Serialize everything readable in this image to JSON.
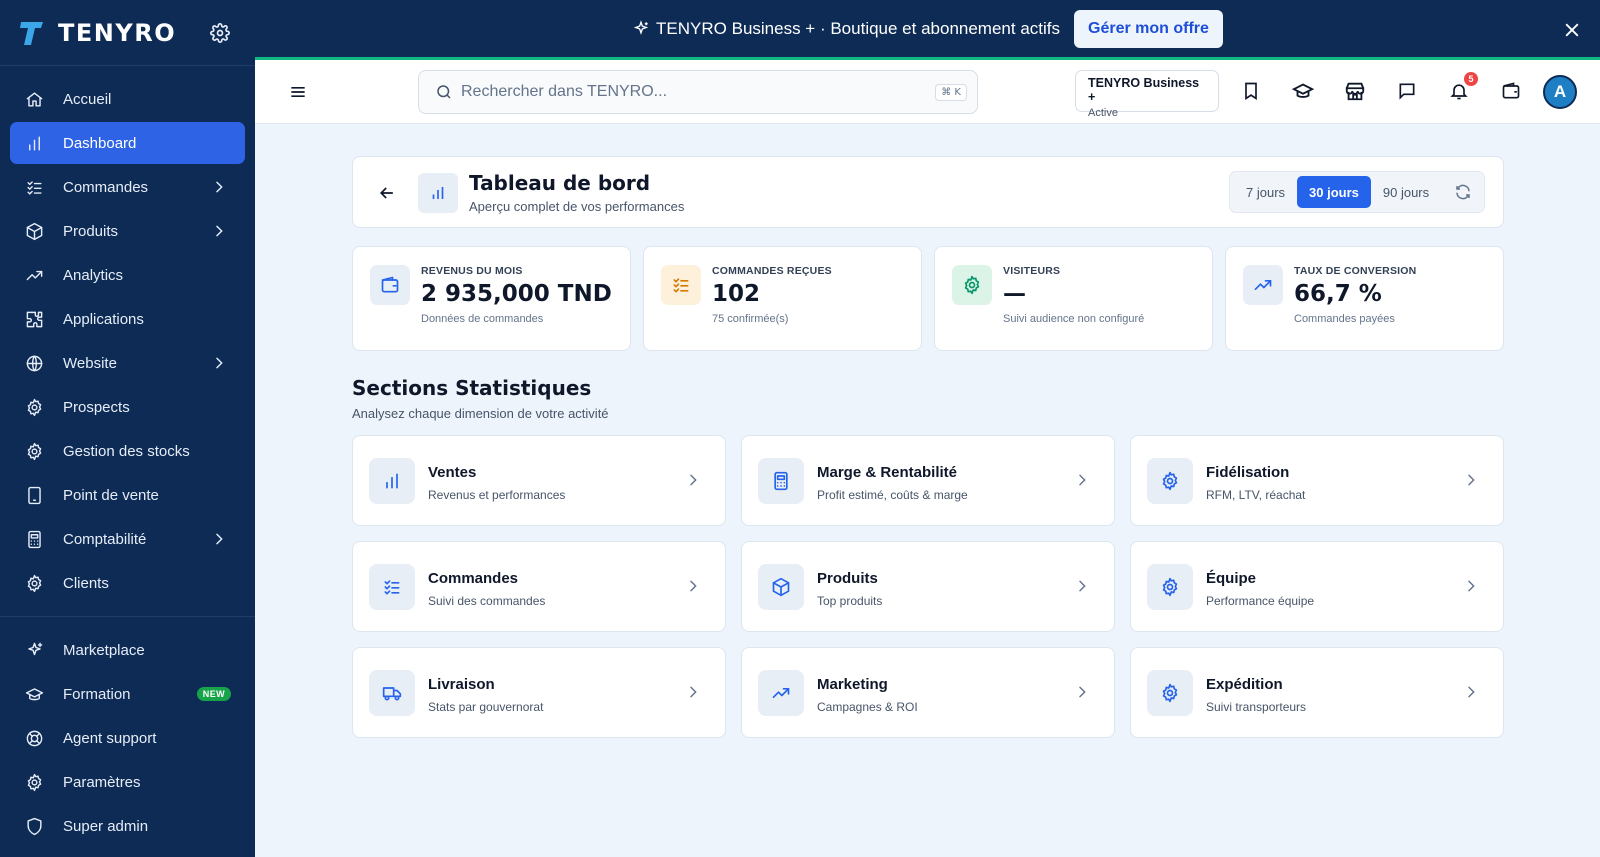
{
  "brand": {
    "name": "TENYRO"
  },
  "sidebar": {
    "items": [
      {
        "label": "Accueil",
        "icon": "home-icon"
      },
      {
        "label": "Dashboard",
        "icon": "bar-chart-icon",
        "active": true
      },
      {
        "label": "Commandes",
        "icon": "checklist-icon",
        "expandable": true
      },
      {
        "label": "Produits",
        "icon": "box-icon",
        "expandable": true
      },
      {
        "label": "Analytics",
        "icon": "trend-icon"
      },
      {
        "label": "Applications",
        "icon": "puzzle-icon"
      },
      {
        "label": "Website",
        "icon": "globe-icon",
        "expandable": true
      },
      {
        "label": "Prospects",
        "icon": "gear-icon"
      },
      {
        "label": "Gestion des stocks",
        "icon": "gear-icon"
      },
      {
        "label": "Point de vente",
        "icon": "tablet-icon"
      },
      {
        "label": "Comptabilité",
        "icon": "calculator-icon",
        "expandable": true
      },
      {
        "label": "Clients",
        "icon": "gear-icon"
      }
    ],
    "bottom_items": [
      {
        "label": "Marketplace",
        "icon": "sparkle-icon"
      },
      {
        "label": "Formation",
        "icon": "graduation-cap-icon",
        "badge": "NEW"
      },
      {
        "label": "Agent support",
        "icon": "lifebuoy-icon"
      },
      {
        "label": "Paramètres",
        "icon": "gear-icon"
      },
      {
        "label": "Super admin",
        "icon": "shield-icon"
      }
    ]
  },
  "banner": {
    "text": "TENYRO Business + · Boutique et abonnement actifs",
    "button": "Gérer mon offre"
  },
  "topbar": {
    "search_placeholder": "Rechercher dans TENYRO...",
    "shortcut": "⌘ K",
    "plan_name": "TENYRO Business +",
    "plan_status": "Active",
    "notifications": "5",
    "avatar": "A"
  },
  "page": {
    "title": "Tableau de bord",
    "subtitle": "Aperçu complet de vos performances",
    "ranges": [
      "7 jours",
      "30 jours",
      "90 jours"
    ],
    "active_range": "30 jours"
  },
  "kpis": [
    {
      "label": "REVENUS DU MOIS",
      "value": "2 935,000 TND",
      "sub": "Données de commandes",
      "icon": "wallet-icon",
      "bg": "#e8eef6",
      "color": "#2563eb"
    },
    {
      "label": "COMMANDES REÇUES",
      "value": "102",
      "sub": "75 confirmée(s)",
      "icon": "checklist-icon",
      "bg": "#fdf1dc",
      "color": "#d97706"
    },
    {
      "label": "VISITEURS",
      "value": "—",
      "sub": "Suivi audience non configuré",
      "icon": "gear-icon",
      "bg": "#dcf3e8",
      "color": "#059669"
    },
    {
      "label": "TAUX DE CONVERSION",
      "value": "66,7 %",
      "sub": "Commandes payées",
      "icon": "trend-icon",
      "bg": "#e8eef6",
      "color": "#2563eb"
    }
  ],
  "sections": {
    "title": "Sections Statistiques",
    "subtitle": "Analysez chaque dimension de votre activité",
    "cards": [
      {
        "title": "Ventes",
        "sub": "Revenus et performances",
        "icon": "bar-chart-icon"
      },
      {
        "title": "Marge & Rentabilité",
        "sub": "Profit estimé, coûts & marge",
        "icon": "calculator-icon"
      },
      {
        "title": "Fidélisation",
        "sub": "RFM, LTV, réachat",
        "icon": "gear-icon"
      },
      {
        "title": "Commandes",
        "sub": "Suivi des commandes",
        "icon": "checklist-icon"
      },
      {
        "title": "Produits",
        "sub": "Top produits",
        "icon": "box-icon"
      },
      {
        "title": "Équipe",
        "sub": "Performance équipe",
        "icon": "gear-icon"
      },
      {
        "title": "Livraison",
        "sub": "Stats par gouvernorat",
        "icon": "truck-icon"
      },
      {
        "title": "Marketing",
        "sub": "Campagnes & ROI",
        "icon": "trend-icon"
      },
      {
        "title": "Expédition",
        "sub": "Suivi transporteurs",
        "icon": "gear-icon"
      }
    ]
  }
}
